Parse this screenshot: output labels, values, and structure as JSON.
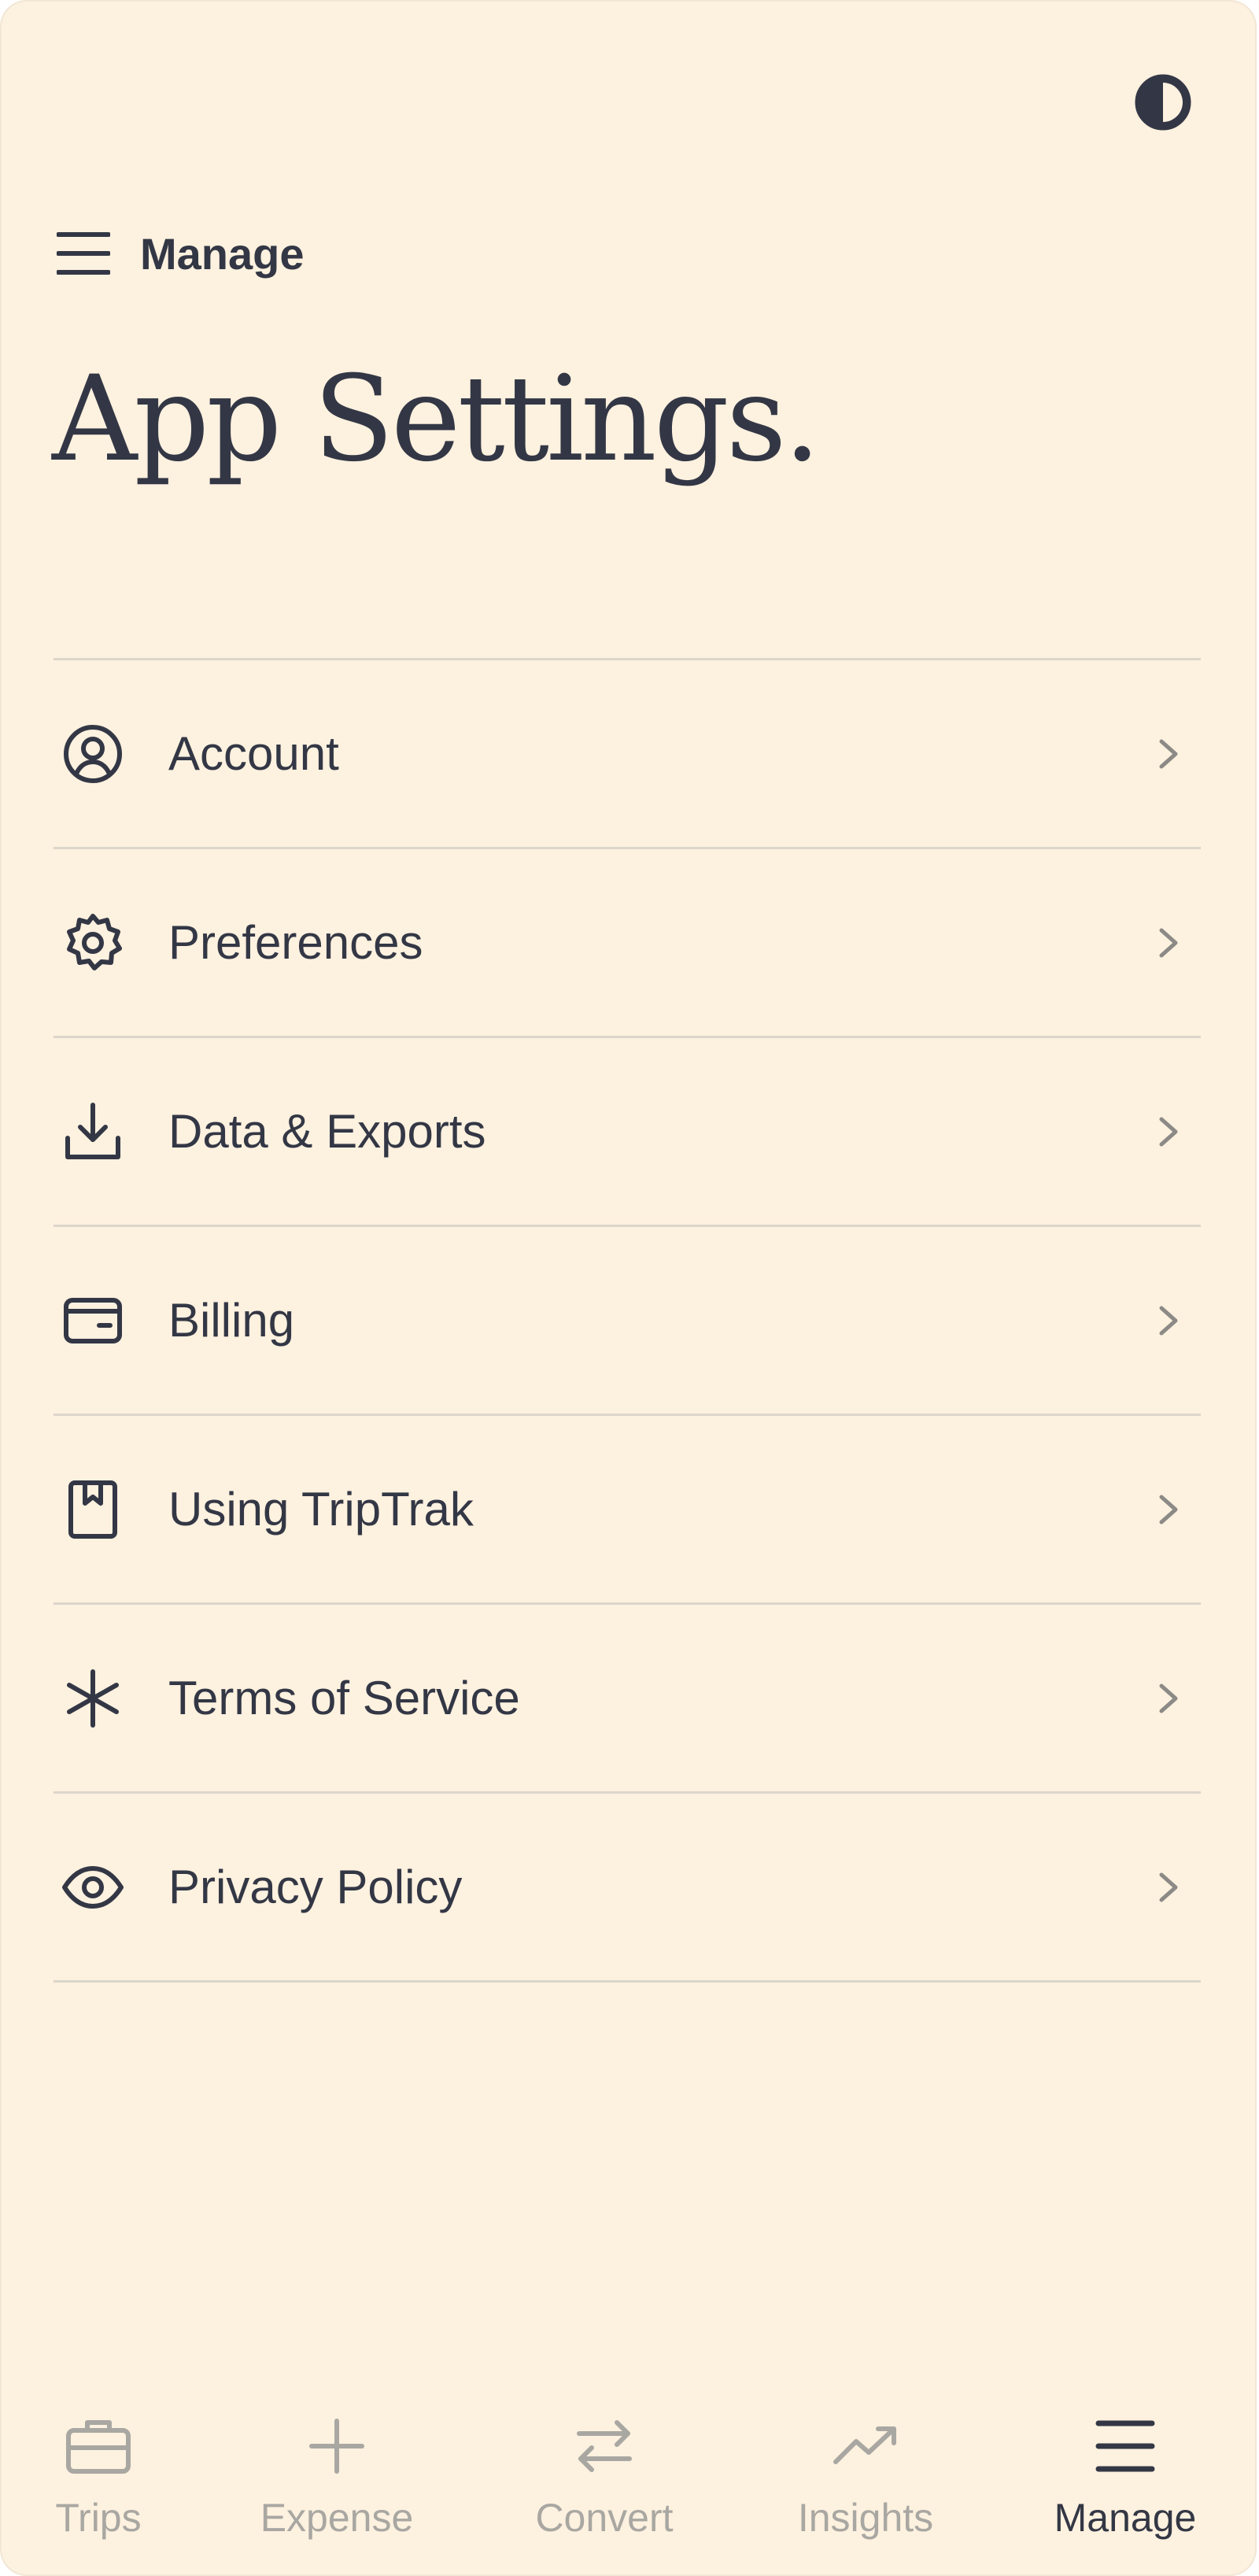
{
  "header": {
    "theme_toggle_icon": "contrast-icon",
    "menu_icon": "menu-icon",
    "breadcrumb": "Manage",
    "title": "App Settings."
  },
  "settings": {
    "items": [
      {
        "label": "Account",
        "icon": "user-circle-icon"
      },
      {
        "label": "Preferences",
        "icon": "gear-icon"
      },
      {
        "label": "Data & Exports",
        "icon": "download-icon"
      },
      {
        "label": "Billing",
        "icon": "wallet-icon"
      },
      {
        "label": "Using TripTrak",
        "icon": "book-icon"
      },
      {
        "label": "Terms of Service",
        "icon": "asterisk-icon"
      },
      {
        "label": "Privacy Policy",
        "icon": "eye-icon"
      }
    ]
  },
  "tabbar": {
    "tabs": [
      {
        "label": "Trips",
        "icon": "briefcase-icon",
        "active": false
      },
      {
        "label": "Expense",
        "icon": "plus-icon",
        "active": false
      },
      {
        "label": "Convert",
        "icon": "swap-icon",
        "active": false
      },
      {
        "label": "Insights",
        "icon": "trend-up-icon",
        "active": false
      },
      {
        "label": "Manage",
        "icon": "menu-icon",
        "active": true
      }
    ]
  },
  "colors": {
    "background": "#fdf1df",
    "text": "#333745",
    "muted": "#a9a7a2",
    "divider": "#dcd6cb"
  }
}
